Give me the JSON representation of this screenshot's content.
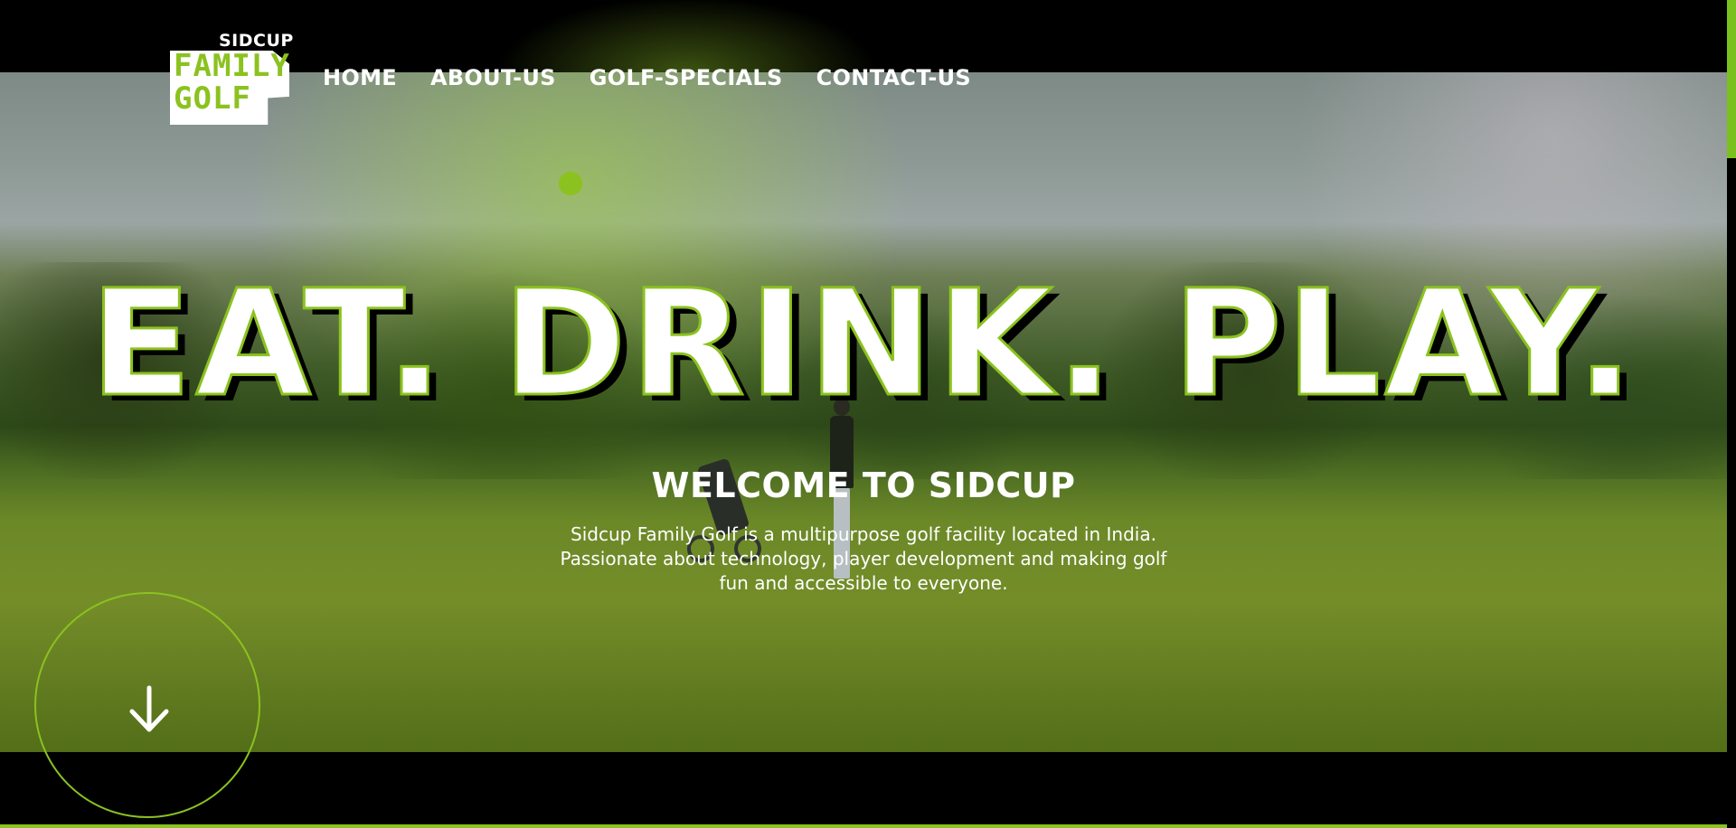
{
  "brand": {
    "logo_top": "SIDCUP",
    "logo_line1": "FAMILY",
    "logo_line2": "GOLF",
    "accent_color": "#8bc21f"
  },
  "nav": {
    "items": [
      {
        "label": "HOME"
      },
      {
        "label": "ABOUT-US"
      },
      {
        "label": "GOLF-SPECIALS"
      },
      {
        "label": "CONTACT-US"
      }
    ]
  },
  "hero": {
    "headline": "EAT. DRINK. PLAY.",
    "welcome": "WELCOME TO SIDCUP",
    "blurb_line1": "Sidcup Family Golf is a multipurpose golf facility located in India.",
    "blurb_line2": "Passionate about technology, player development and making golf",
    "blurb_line3": "fun and accessible to everyone."
  },
  "icons": {
    "scroll_down": "arrow-down-icon"
  }
}
